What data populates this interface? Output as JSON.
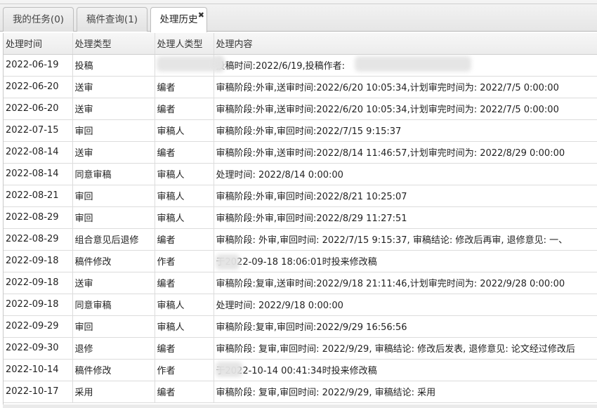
{
  "tabs": [
    {
      "label": "我的任务(0)",
      "active": false
    },
    {
      "label": "稿件查询(1)",
      "active": false
    },
    {
      "label": "处理历史",
      "active": true,
      "close_icon": "close-icon"
    }
  ],
  "table": {
    "columns": [
      "处理时间",
      "处理类型",
      "处理人类型",
      "处理内容"
    ],
    "rows": [
      {
        "date": "2022-06-19",
        "type": "投稿",
        "role": "",
        "content": "投稿时间:2022/6/19,投稿作者:"
      },
      {
        "date": "2022-06-20",
        "type": "送审",
        "role": "编者",
        "content": "审稿阶段:外审,送审时间:2022/6/20 10:05:34,计划审完时间为: 2022/7/5 0:00:00"
      },
      {
        "date": "2022-06-20",
        "type": "送审",
        "role": "编者",
        "content": "审稿阶段:外审,送审时间:2022/6/20 10:05:34,计划审完时间为: 2022/7/5 0:00:00"
      },
      {
        "date": "2022-07-15",
        "type": "审回",
        "role": "审稿人",
        "content": "审稿阶段:外审,审回时间:2022/7/15 9:15:37"
      },
      {
        "date": "2022-08-14",
        "type": "送审",
        "role": "编者",
        "content": "审稿阶段:外审,送审时间:2022/8/14 11:46:57,计划审完时间为: 2022/8/29 0:00:00"
      },
      {
        "date": "2022-08-14",
        "type": "同意审稿",
        "role": "审稿人",
        "content": "处理时间: 2022/8/14 0:00:00"
      },
      {
        "date": "2022-08-21",
        "type": "审回",
        "role": "审稿人",
        "content": "审稿阶段:外审,审回时间:2022/8/21 10:25:07"
      },
      {
        "date": "2022-08-29",
        "type": "审回",
        "role": "审稿人",
        "content": "审稿阶段:外审,审回时间:2022/8/29 11:27:51"
      },
      {
        "date": "2022-08-29",
        "type": "组合意见后退修",
        "role": "编者",
        "content": "审稿阶段: 外审,审回时间: 2022/7/15 9:15:37, 审稿结论: 修改后再审, 退修意见: 一、"
      },
      {
        "date": "2022-09-18",
        "type": "稿件修改",
        "role": "作者",
        "content": "于2022-09-18 18:06:01时投来修改稿"
      },
      {
        "date": "2022-09-18",
        "type": "送审",
        "role": "编者",
        "content": "审稿阶段:复审,送审时间:2022/9/18 21:11:46,计划审完时间为: 2022/9/28 0:00:00"
      },
      {
        "date": "2022-09-18",
        "type": "同意审稿",
        "role": "审稿人",
        "content": "处理时间: 2022/9/18 0:00:00"
      },
      {
        "date": "2022-09-29",
        "type": "审回",
        "role": "审稿人",
        "content": "审稿阶段:复审,审回时间:2022/9/29 16:56:56"
      },
      {
        "date": "2022-09-30",
        "type": "退修",
        "role": "编者",
        "content": "审稿阶段: 复审,审回时间: 2022/9/29, 审稿结论: 修改后发表, 退修意见: 论文经过修改后"
      },
      {
        "date": "2022-10-14",
        "type": "稿件修改",
        "role": "作者",
        "content": "于2022-10-14 00:41:34时投来修改稿"
      },
      {
        "date": "2022-10-17",
        "type": "采用",
        "role": "编者",
        "content": "审稿阶段: 复审,审回时间: 2022/9/29, 审稿结论: 采用"
      }
    ]
  }
}
